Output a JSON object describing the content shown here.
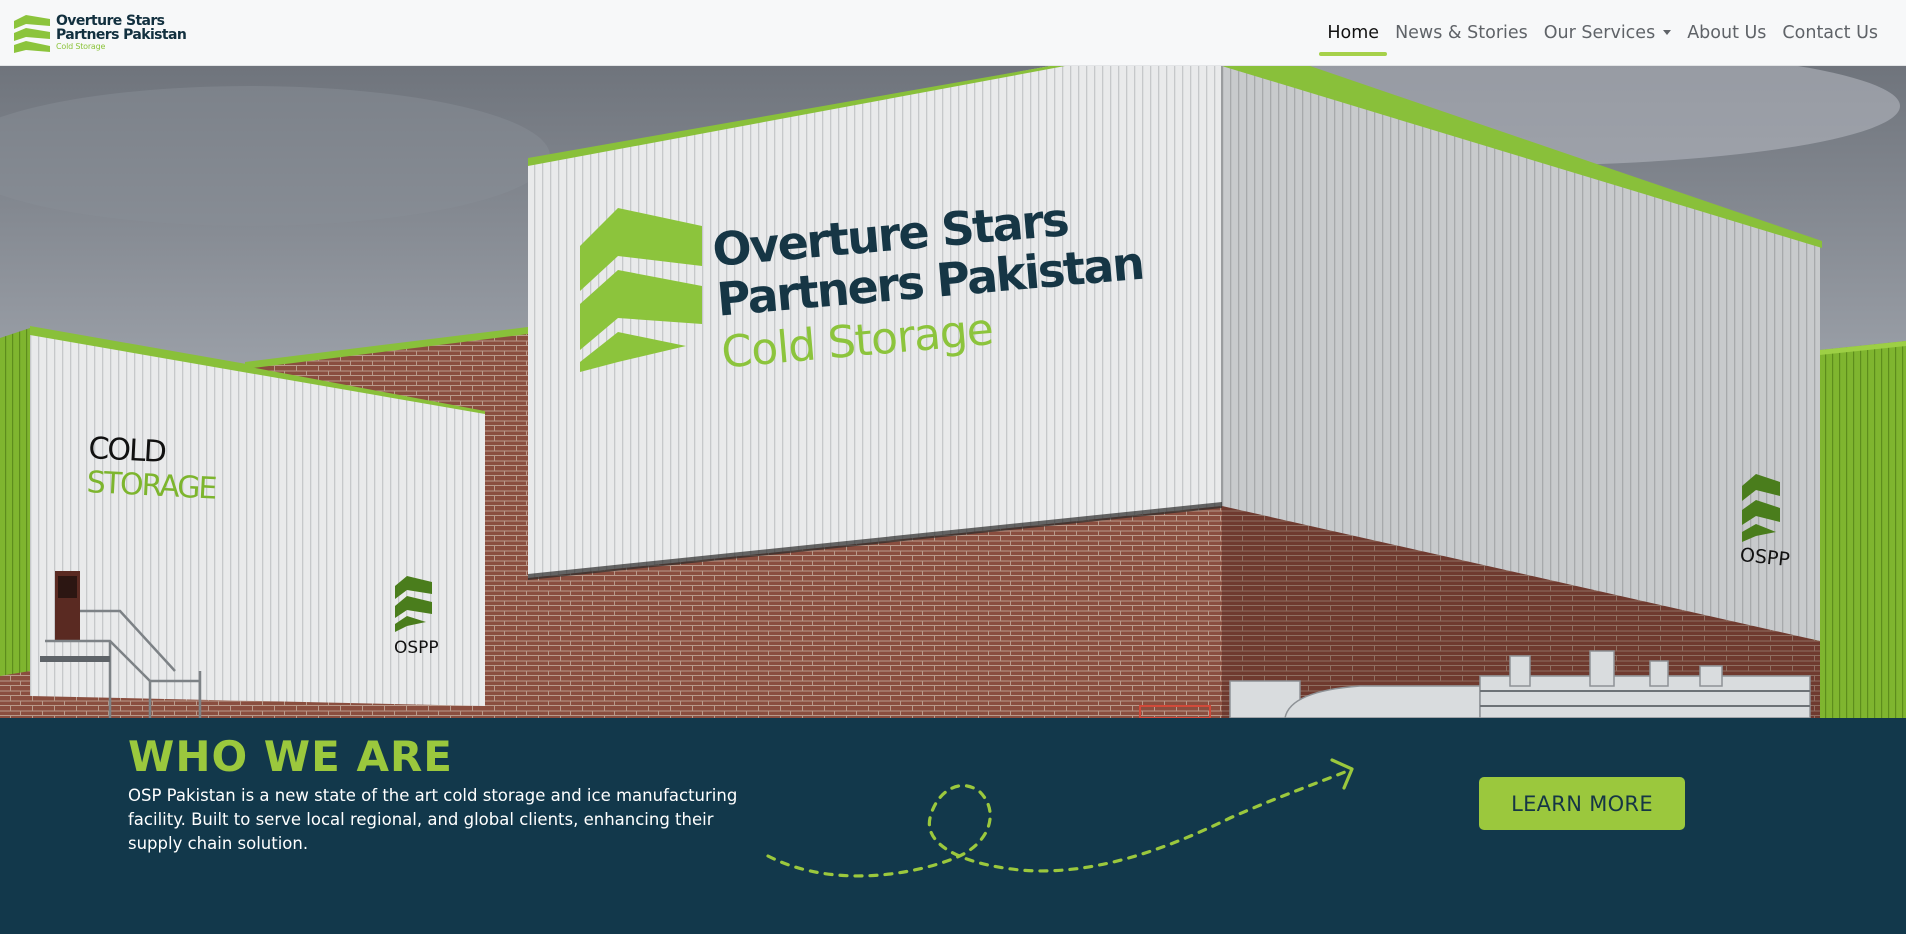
{
  "brand": {
    "line1": "Overture Stars",
    "line2": "Partners Pakistan",
    "line3": "Cold Storage",
    "logo_icon": "osp-logo-icon"
  },
  "nav": {
    "items": [
      {
        "label": "Home",
        "active": true
      },
      {
        "label": "News & Stories",
        "active": false
      },
      {
        "label": "Our Services",
        "active": false,
        "dropdown": true
      },
      {
        "label": "About Us",
        "active": false
      },
      {
        "label": "Contact Us",
        "active": false
      }
    ]
  },
  "hero": {
    "main_sign": {
      "line1": "Overture Stars",
      "line2": "Partners Pakistan",
      "line3": "Cold Storage"
    },
    "left_sign": {
      "line1": "COLD",
      "line2": "STORAGE"
    },
    "badge_text": "OSPP"
  },
  "who": {
    "title": "WHO WE ARE",
    "text": "OSP Pakistan is a new state of the art cold storage and ice manufacturing facility. Built to serve local regional, and global clients, enhancing their supply chain solution.",
    "button": "LEARN MORE"
  },
  "colors": {
    "accent_green": "#9bc83d",
    "navy": "#12384b",
    "active_underline": "#a6d14a"
  }
}
